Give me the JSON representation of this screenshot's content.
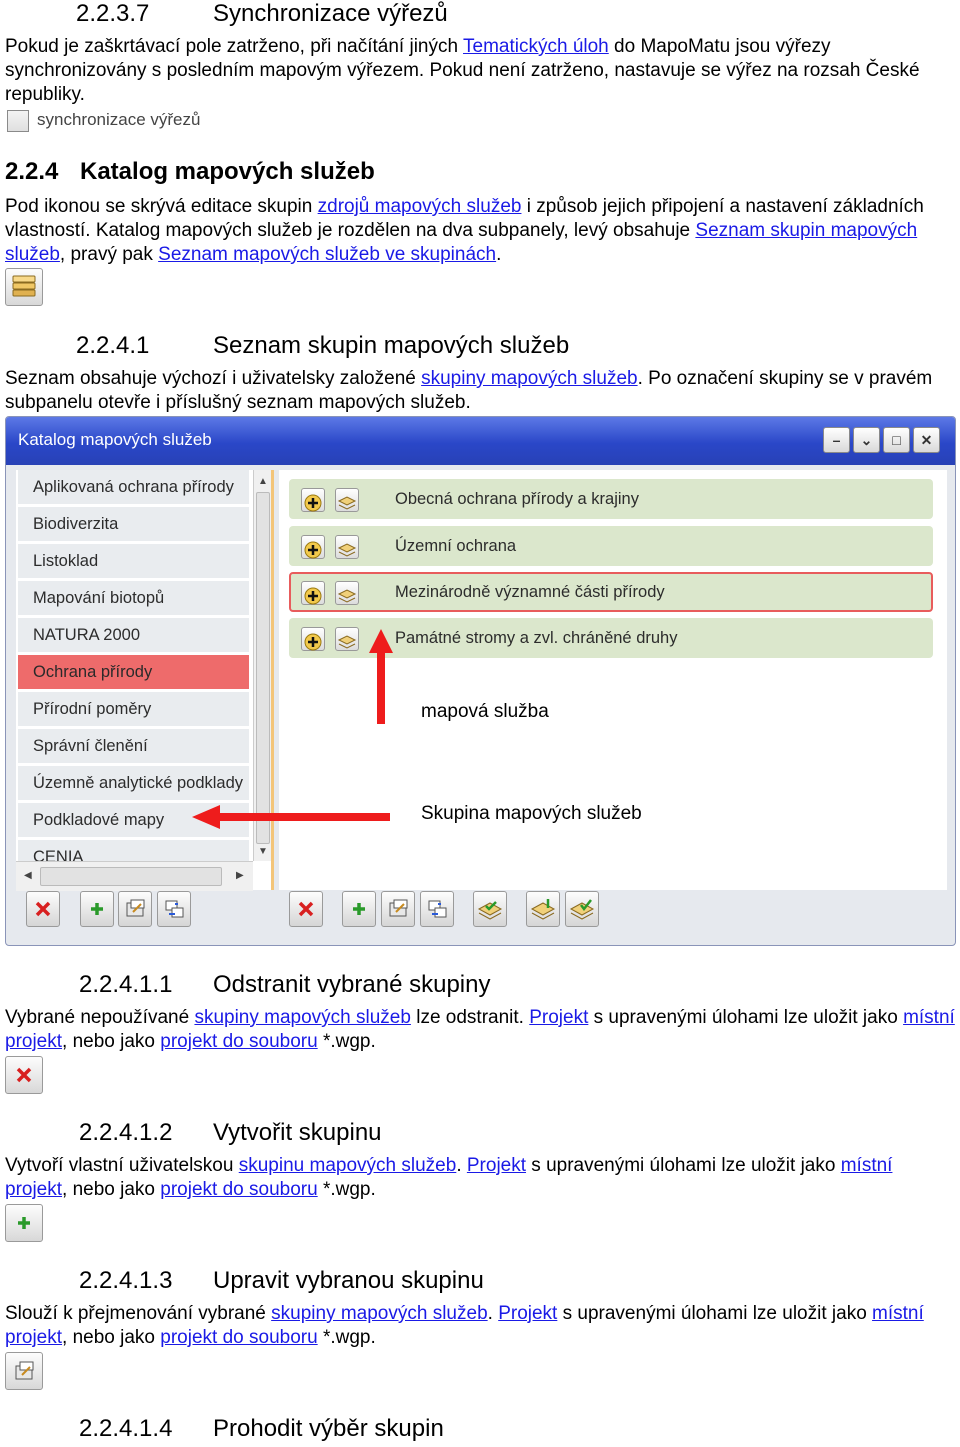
{
  "s1": {
    "num": "2.2.3.7",
    "title": "Synchronizace výřezů",
    "p1": "Pokud je zaškrtávací pole zatrženo, při načítání jiných ",
    "p1_link": "Tematických úloh",
    "p1_tail": " do MapoMatu jsou výřezy synchronizovány s posledním mapovým výřezem. Pokud není zatrženo, nastavuje se výřez na rozsah České republiky.",
    "checkbox_label": "synchronizace výřezů"
  },
  "s2": {
    "num": "2.2.4",
    "title": "Katalog mapových služeb",
    "t1": "Pod ikonou se skrývá editace skupin ",
    "l1": "zdrojů mapových služeb",
    "t2": " i způsob jejich připojení a nastavení základních vlastností. Katalog mapových služeb je rozdělen na dva subpanely, levý obsahuje ",
    "l2": "Seznam skupin mapových služeb",
    "t3": ", pravý pak ",
    "l3": "Seznam mapových služeb ve skupinách",
    "t4": "."
  },
  "s3": {
    "num": "2.2.4.1",
    "title": "Seznam skupin mapových služeb",
    "t1": "Seznam obsahuje výchozí i uživatelsky založené ",
    "l1": "skupiny mapových služeb",
    "t2": ". Po označení skupiny se v pravém subpanelu otevře i příslušný seznam mapových služeb."
  },
  "window": {
    "title": "Katalog mapových služeb",
    "groups": [
      "Aplikovaná ochrana přírody",
      "Biodiverzita",
      "Listoklad",
      "Mapování biotopů",
      "NATURA 2000",
      "Ochrana přírody",
      "Přírodní poměry",
      "Správní členění",
      "Územně analytické podklady",
      "Podkladové mapy",
      "CENIA"
    ],
    "selected_group": "Ochrana přírody",
    "services": [
      "Obecná ochrana přírody a krajiny",
      "Územní ochrana",
      "Mezinárodně významné části přírody",
      "Památné stromy a zvl. chráněné druhy"
    ],
    "selected_service": "Mezinárodně významné části přírody",
    "annotation_service": "mapová služba",
    "annotation_group": "Skupina mapových služeb"
  },
  "s4": {
    "num": "2.2.4.1.1",
    "title": "Odstranit vybrané skupiny",
    "t1": "Vybrané nepoužívané ",
    "l1": "skupiny mapových služeb",
    "t2": " lze odstranit. ",
    "l2": "Projekt",
    "t3": " s upravenými úlohami lze uložit jako ",
    "l3": "místní projekt",
    "t4": ", nebo jako ",
    "l4": "projekt do souboru",
    "t5": " *.wgp."
  },
  "s5": {
    "num": "2.2.4.1.2",
    "title": "Vytvořit skupinu",
    "t1": "Vytvoří vlastní uživatelskou ",
    "l1": "skupinu mapových služeb",
    "t2": ". ",
    "l2": "Projekt",
    "t3": " s upravenými úlohami lze uložit jako ",
    "l3": "místní projekt",
    "t4": ", nebo jako ",
    "l4": "projekt do souboru",
    "t5": " *.wgp."
  },
  "s6": {
    "num": "2.2.4.1.3",
    "title": "Upravit vybranou skupinu",
    "t1": "Slouží k přejmenování vybrané ",
    "l1": "skupiny mapových služeb",
    "t2": ". ",
    "l2": "Projekt",
    "t3": " s upravenými úlohami lze uložit jako ",
    "l3": "místní projekt",
    "t4": ", nebo jako ",
    "l4": "projekt do souboru",
    "t5": " *.wgp."
  },
  "s7": {
    "num": "2.2.4.1.4",
    "title": "Prohodit výběr skupin"
  },
  "colors": {
    "link": "#1a1ae6",
    "title_bar": "#2a47c8",
    "selected_group": "#ee6b6b",
    "service_row": "#dbe7cc",
    "arrow": "#ee1c1c"
  }
}
